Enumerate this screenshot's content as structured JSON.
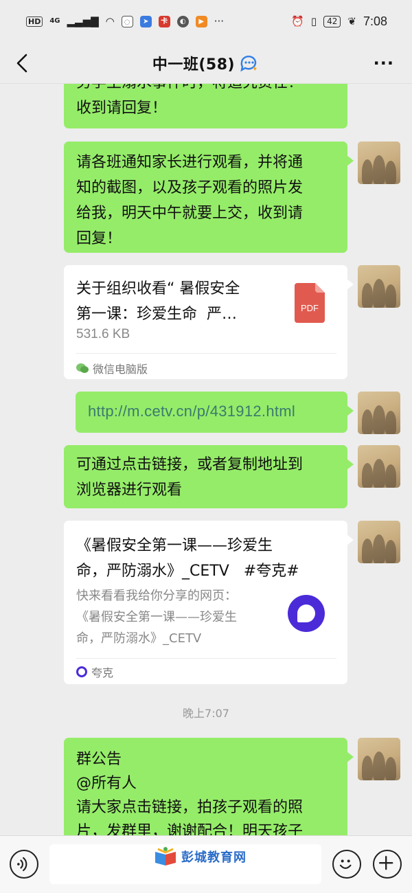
{
  "status_bar": {
    "hd": "HD",
    "network": "4G",
    "more": "···",
    "battery": "42",
    "time": "7:08"
  },
  "nav": {
    "title": "中一班(58)",
    "more": "···"
  },
  "messages": {
    "m1": "务学生溺水事件时，将追究责任！\n收到请回复！",
    "m2": "请各班通知家长进行观看，并将通\n知的截图，以及孩子观看的照片发\n给我，明天中午就要上交，收到请\n回复！",
    "file": {
      "title": "关于组织收看“ 暑假安全\n第一课：珍爱生命  严…",
      "size": "531.6 KB",
      "icon_label": "PDF",
      "source": "微信电脑版"
    },
    "url": "http://m.cetv.cn/p/431912.html",
    "m4": "可通过点击链接，或者复制地址到\n浏览器进行观看",
    "link": {
      "title": "《暑假安全第一课——珍爱生\n命，严防溺水》_CETV   #夸克#",
      "desc": "快来看看我给你分享的网页：\n《暑假安全第一课——珍爱生\n命，严防溺水》_CETV",
      "source": "夸克"
    },
    "timestamp": "晚上7:07",
    "announcement": "群公告\n@所有人\n请大家点击链接，拍孩子观看的照\n片，发群里，谢谢配合！明天孩子"
  },
  "watermark": "彭城教育网",
  "colors": {
    "bubble_green": "#95ec69",
    "bubble_white": "#ffffff",
    "chat_bg": "#ededed",
    "pdf_red": "#e15a4f",
    "quark_purple": "#4b2bd8",
    "link_text": "#3b7a6e"
  },
  "icons": [
    "back-icon",
    "group-chat-bubble-icon",
    "more-icon",
    "pdf-file-icon",
    "wechat-pc-icon",
    "quark-icon",
    "voice-icon",
    "emoji-icon",
    "plus-icon"
  ]
}
